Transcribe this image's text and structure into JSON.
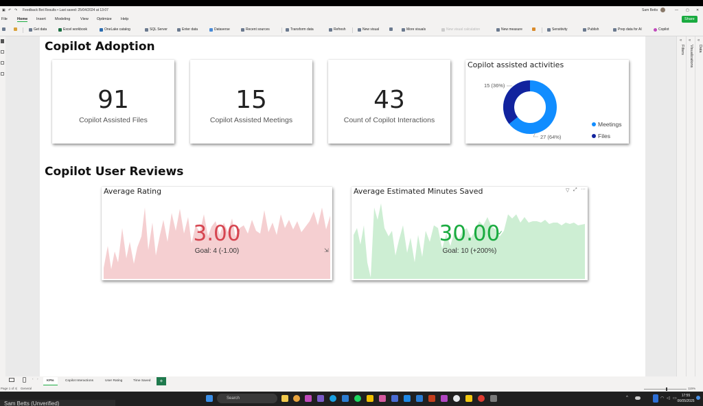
{
  "app": {
    "title": "Feedback Bot Results • Last saved: 25/04/2024 at 13:07",
    "user": "Sam Betts",
    "share_label": "Share"
  },
  "menu": [
    "File",
    "Home",
    "Insert",
    "Modeling",
    "View",
    "Optimize",
    "Help"
  ],
  "ribbon": [
    "Get data",
    "Excel workbook",
    "OneLake catalog",
    "SQL Server",
    "Enter data",
    "Dataverse",
    "Recent sources",
    "Transform data",
    "Refresh",
    "New visual",
    "More visuals",
    "New visual calculation",
    "New measure",
    "Sensitivity",
    "Publish",
    "Prep data for AI",
    "Copilot"
  ],
  "panes": {
    "filters": "Filters",
    "visualizations": "Visualizations",
    "data": "Data"
  },
  "section1": {
    "title": "Copilot Adoption"
  },
  "kpis": [
    {
      "value": "91",
      "label": "Copilot Assisted Files"
    },
    {
      "value": "15",
      "label": "Copilot Assisted Meetings"
    },
    {
      "value": "43",
      "label": "Count of Copilot Interactions"
    }
  ],
  "donut": {
    "title": "Copilot assisted activities",
    "label_meetings": "27 (64%)",
    "label_files": "15 (36%)",
    "legend_meetings": "Meetings",
    "legend_files": "Files",
    "color_meetings": "#118dff",
    "color_files": "#12239e"
  },
  "section2": {
    "title": "Copilot User Reviews"
  },
  "rating": {
    "title": "Average Rating",
    "value": "3.00",
    "goal": "Goal: 4 (-1.00)",
    "indicator": "!",
    "color": "#d64550"
  },
  "minutes": {
    "title": "Average Estimated Minutes Saved",
    "value": "30.00",
    "goal": "Goal: 10 (+200%)",
    "indicator": "✓",
    "color": "#1aab40"
  },
  "tabs": [
    "KPIs",
    "Copilot Interactions",
    "User Rating",
    "Time Saved"
  ],
  "add_page": "+",
  "status": {
    "page": "Page 1 of 4",
    "sensitivity": "General",
    "zoom": "115%"
  },
  "taskbar": {
    "search_placeholder": "Search",
    "time": "17:55",
    "date": "06/05/2025",
    "user_window": "Sam Betts (Unverified)"
  }
}
